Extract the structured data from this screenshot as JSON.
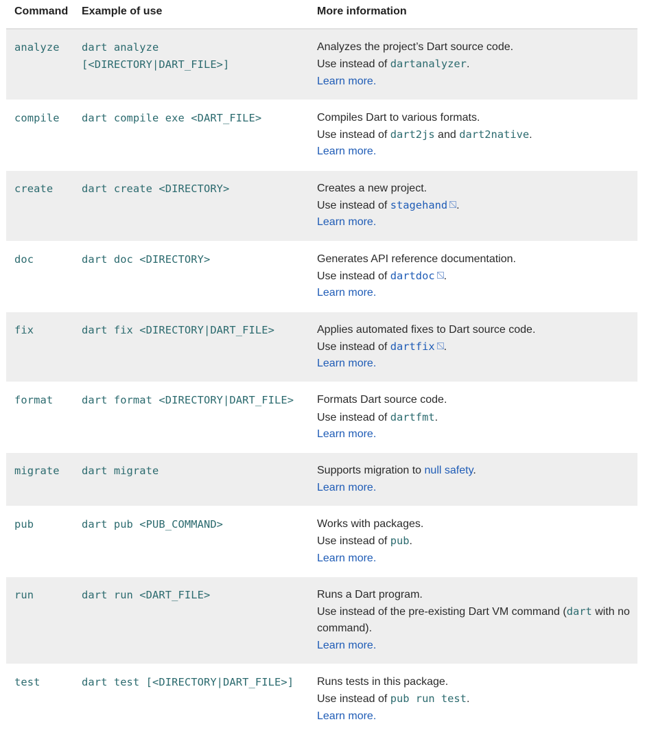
{
  "headers": {
    "command": "Command",
    "example": "Example of use",
    "info": "More information"
  },
  "rows": [
    {
      "command": "analyze",
      "example": "dart analyze [<DIRECTORY|DART_FILE>]",
      "description": "Analyzes the project’s Source code.",
      "use_prefix": "Use instead of ",
      "use_code": "dartanalyzer",
      "use_suffix": ".",
      "learn_more": "Learn more."
    },
    {
      "command": "compile",
      "example": "dart compile exe <DART_FILE>",
      "description": "Compiles Dart to various formats.",
      "use_prefix": "Use instead of ",
      "use_code": "dart2js",
      "use_and": " and ",
      "use_code2": "dart2native",
      "use_suffix": ".",
      "learn_more": "Learn more."
    },
    {
      "command": "create",
      "example": "dart create <DIRECTORY>",
      "description": "Creates a new project.",
      "use_prefix": "Use instead of ",
      "use_code": "stagehand",
      "use_suffix": ".",
      "learn_more": "Learn more."
    },
    {
      "command": "doc",
      "example": "dart doc <DIRECTORY>",
      "description": "Generates API reference documentation.",
      "use_prefix": "Use instead of ",
      "use_code": "dartdoc",
      "use_suffix": ".",
      "learn_more": "Learn more."
    },
    {
      "command": "fix",
      "example": "dart fix <DIRECTORY|DART_FILE>",
      "description": "Applies automated fixes to Dart source code.",
      "use_prefix": "Use instead of ",
      "use_code": "dartfix",
      "use_suffix": ".",
      "learn_more": "Learn more."
    },
    {
      "command": "format",
      "example": "dart format <DIRECTORY|DART_FILE>",
      "description": "Formats Dart source code.",
      "use_prefix": "Use instead of ",
      "use_code": "dartfmt",
      "use_suffix": ".",
      "learn_more": "Learn more."
    },
    {
      "command": "migrate",
      "example": "dart migrate",
      "description_prefix": "Supports migration to ",
      "description_link": "null safety",
      "description_suffix": ".",
      "learn_more": "Learn more."
    },
    {
      "command": "pub",
      "example": "dart pub <PUB_COMMAND>",
      "description": "Works with packages.",
      "use_prefix": "Use instead of ",
      "use_code": "pub",
      "use_suffix": ".",
      "learn_more": "Learn more."
    },
    {
      "command": "run",
      "example": "dart run <DART_FILE>",
      "description": "Runs a Dart program.",
      "use_prefix": "Use instead of the pre-existing Dart VM command (",
      "use_code": "dart",
      "use_suffix": " with no command).",
      "learn_more": "Learn more."
    },
    {
      "command": "test",
      "example": "dart test [<DIRECTORY|DART_FILE>]",
      "description": "Runs tests in this package.",
      "use_prefix": "Use instead of ",
      "use_code": "pub run test",
      "use_suffix": ".",
      "learn_more": "Learn more."
    }
  ]
}
